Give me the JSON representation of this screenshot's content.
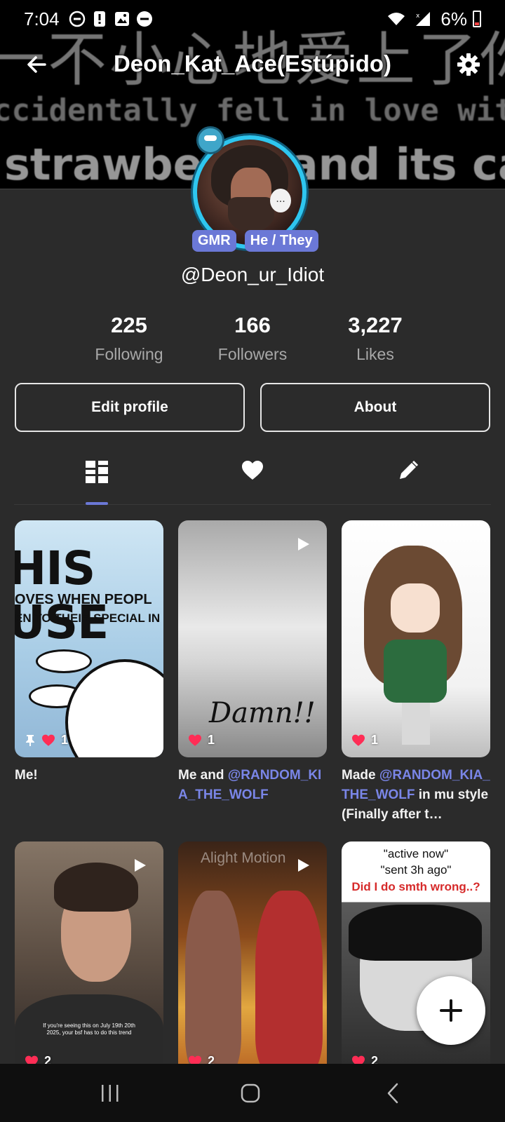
{
  "status_bar": {
    "time": "7:04",
    "battery": "6%",
    "icons": [
      "do-not-disturb-icon",
      "alert-icon",
      "image-icon",
      "minus-circle-icon",
      "wifi-icon",
      "signal-icon",
      "battery-low-icon"
    ]
  },
  "header": {
    "title": "Deon_Kat_Ace(Estúpido)",
    "banner_lines": [
      "一不小心地爱上了你",
      "ccidentally fell in love with y",
      "strawberry and its ca"
    ]
  },
  "profile": {
    "badges": [
      "GMR",
      "He / They"
    ],
    "handle": "@Deon_ur_Idiot",
    "avatar_bubble": "..."
  },
  "stats": [
    {
      "value": "225",
      "label": "Following"
    },
    {
      "value": "166",
      "label": "Followers"
    },
    {
      "value": "3,227",
      "label": "Likes"
    }
  ],
  "actions": {
    "edit_profile": "Edit profile",
    "about": "About"
  },
  "tabs": [
    "posts-grid-icon",
    "liked-heart-icon",
    "drafts-pencil-icon"
  ],
  "posts": [
    {
      "likes": "1",
      "pinned": true,
      "thumb_title": "HIS USE",
      "thumb_sub": "OVES WHEN PEOPL",
      "thumb_sub2": "EN TO THEIR SPECIAL IN",
      "caption": "Me!"
    },
    {
      "likes": "1",
      "video": true,
      "thumb_text": "Damn!!",
      "caption_prefix": "Me and ",
      "caption_mention": "@RANDOM_KIA_THE_WOLF"
    },
    {
      "likes": "1",
      "caption_prefix": "Made ",
      "caption_mention": "@RANDOM_KIA_THE_WOLF",
      "caption_suffix": " in mu style (Finally after t…"
    },
    {
      "likes": "2",
      "video": true,
      "thumb_text": "If you're seeing this on July 19th 20th 2025, your bsf has to do this trend"
    },
    {
      "likes": "2",
      "video": true,
      "thumb_watermark": "Alight Motion"
    },
    {
      "likes": "2",
      "thumb_line1": "\"active now\"",
      "thumb_line2": "\"sent 3h ago\"",
      "thumb_line3": "Did I do smth wrong..?"
    }
  ],
  "colors": {
    "background": "#2b2b2b",
    "accent": "#6b78d6",
    "avatar_ring": "#2ec6ef",
    "like": "#ff2d55"
  }
}
